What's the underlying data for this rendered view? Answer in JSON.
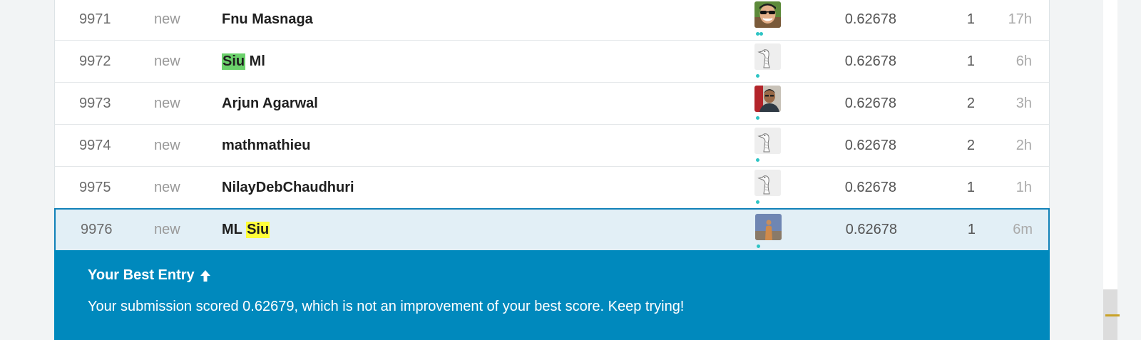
{
  "leaderboard": {
    "rows": [
      {
        "rank": "9971",
        "delta": "new",
        "team": "Fnu Masnaga",
        "score": "0.62678",
        "entries": "1",
        "last": "17h",
        "avatar": "photo-sunglasses-avatar",
        "dots": 2
      },
      {
        "rank": "9972",
        "delta": "new",
        "team_hl": "Siu",
        "team_rest": " Ml",
        "score": "0.62678",
        "entries": "1",
        "last": "6h",
        "avatar": "goose-sketch-avatar",
        "dots": 1
      },
      {
        "rank": "9973",
        "delta": "new",
        "team": "Arjun Agarwal",
        "score": "0.62678",
        "entries": "2",
        "last": "3h",
        "avatar": "photo-person-avatar",
        "dots": 1
      },
      {
        "rank": "9974",
        "delta": "new",
        "team": "mathmathieu",
        "score": "0.62678",
        "entries": "2",
        "last": "2h",
        "avatar": "goose-sketch-avatar",
        "dots": 1
      },
      {
        "rank": "9975",
        "delta": "new",
        "team": "NilayDebChaudhuri",
        "score": "0.62678",
        "entries": "1",
        "last": "1h",
        "avatar": "goose-sketch-avatar",
        "dots": 1
      },
      {
        "rank": "9976",
        "delta": "new",
        "team_pre": "ML ",
        "team_hl": "Siu",
        "score": "0.62678",
        "entries": "1",
        "last": "6m",
        "avatar": "photo-figure-avatar",
        "dots": 1
      }
    ]
  },
  "banner": {
    "title": "Your Best Entry",
    "icon": "arrow-up-icon",
    "message": "Your submission scored 0.62679, which is not an improvement of your best score. Keep trying!"
  },
  "colors": {
    "banner_bg": "#0089bd",
    "current_row_bg": "#e2eff6",
    "current_row_border": "#1181b8",
    "highlight_green": "#6bd16b",
    "highlight_yellow": "#ffff3a",
    "status_dot": "#2ec4c4"
  }
}
